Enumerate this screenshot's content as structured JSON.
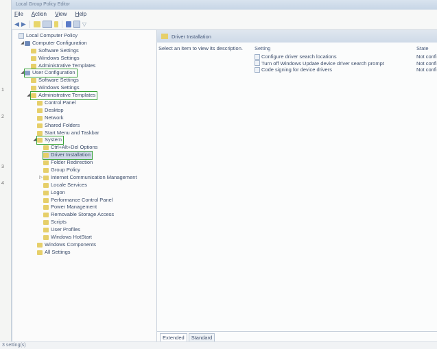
{
  "window": {
    "title": "Local Group Policy Editor"
  },
  "menu": [
    {
      "label": "File",
      "u": "F",
      "rest": "ile"
    },
    {
      "label": "Action",
      "u": "A",
      "rest": "ction"
    },
    {
      "label": "View",
      "u": "V",
      "rest": "iew"
    },
    {
      "label": "Help",
      "u": "H",
      "rest": "elp"
    }
  ],
  "tree": [
    {
      "label": "Local Computer Policy",
      "indent": 0,
      "icon": "doc",
      "exp": ""
    },
    {
      "label": "Computer Configuration",
      "indent": 1,
      "icon": "pc",
      "exp": "◢"
    },
    {
      "label": "Software Settings",
      "indent": 2,
      "icon": "folder",
      "exp": ""
    },
    {
      "label": "Windows Settings",
      "indent": 2,
      "icon": "folder",
      "exp": ""
    },
    {
      "label": "Administrative Templates",
      "indent": 2,
      "icon": "folder",
      "exp": ""
    },
    {
      "label": "User Configuration",
      "indent": 1,
      "icon": "cfg",
      "exp": "◢",
      "highlight": true
    },
    {
      "label": "Software Settings",
      "indent": 2,
      "icon": "folder",
      "exp": ""
    },
    {
      "label": "Windows Settings",
      "indent": 2,
      "icon": "folder",
      "exp": ""
    },
    {
      "label": "Administrative Templates",
      "indent": 2,
      "icon": "folder",
      "exp": "◢",
      "highlight": true
    },
    {
      "label": "Control Panel",
      "indent": 3,
      "icon": "folder",
      "exp": ""
    },
    {
      "label": "Desktop",
      "indent": 3,
      "icon": "folder",
      "exp": ""
    },
    {
      "label": "Network",
      "indent": 3,
      "icon": "folder",
      "exp": ""
    },
    {
      "label": "Shared Folders",
      "indent": 3,
      "icon": "folder",
      "exp": ""
    },
    {
      "label": "Start Menu and Taskbar",
      "indent": 3,
      "icon": "folder",
      "exp": ""
    },
    {
      "label": "System",
      "indent": 3,
      "icon": "folder",
      "exp": "◢",
      "highlight": true
    },
    {
      "label": "Ctrl+Alt+Del Options",
      "indent": 4,
      "icon": "folder",
      "exp": ""
    },
    {
      "label": "Driver Installation",
      "indent": 4,
      "icon": "folder",
      "exp": "",
      "highlight": true,
      "selected": true
    },
    {
      "label": "Folder Redirection",
      "indent": 4,
      "icon": "folder",
      "exp": ""
    },
    {
      "label": "Group Policy",
      "indent": 4,
      "icon": "folder",
      "exp": ""
    },
    {
      "label": "Internet Communication Management",
      "indent": 4,
      "icon": "folder",
      "exp": "▷"
    },
    {
      "label": "Locale Services",
      "indent": 4,
      "icon": "folder",
      "exp": ""
    },
    {
      "label": "Logon",
      "indent": 4,
      "icon": "folder",
      "exp": ""
    },
    {
      "label": "Performance Control Panel",
      "indent": 4,
      "icon": "folder",
      "exp": ""
    },
    {
      "label": "Power Management",
      "indent": 4,
      "icon": "folder",
      "exp": ""
    },
    {
      "label": "Removable Storage Access",
      "indent": 4,
      "icon": "folder",
      "exp": ""
    },
    {
      "label": "Scripts",
      "indent": 4,
      "icon": "folder",
      "exp": ""
    },
    {
      "label": "User Profiles",
      "indent": 4,
      "icon": "folder",
      "exp": ""
    },
    {
      "label": "Windows HotStart",
      "indent": 4,
      "icon": "folder",
      "exp": ""
    },
    {
      "label": "Windows Components",
      "indent": 3,
      "icon": "folder",
      "exp": ""
    },
    {
      "label": "All Settings",
      "indent": 3,
      "icon": "folder",
      "exp": ""
    }
  ],
  "markers": [
    "1",
    "2",
    "3",
    "4"
  ],
  "right": {
    "header": "Driver Installation",
    "description": "Select an item to view its description.",
    "col_setting": "Setting",
    "col_state": "State",
    "rows": [
      {
        "setting": "Configure driver search locations",
        "state": "Not configu"
      },
      {
        "setting": "Turn off Windows Update device driver search prompt",
        "state": "Not configu"
      },
      {
        "setting": "Code signing for device drivers",
        "state": "Not configu"
      }
    ],
    "tabs": [
      "Extended",
      "Standard"
    ]
  },
  "status": "3 setting(s)"
}
